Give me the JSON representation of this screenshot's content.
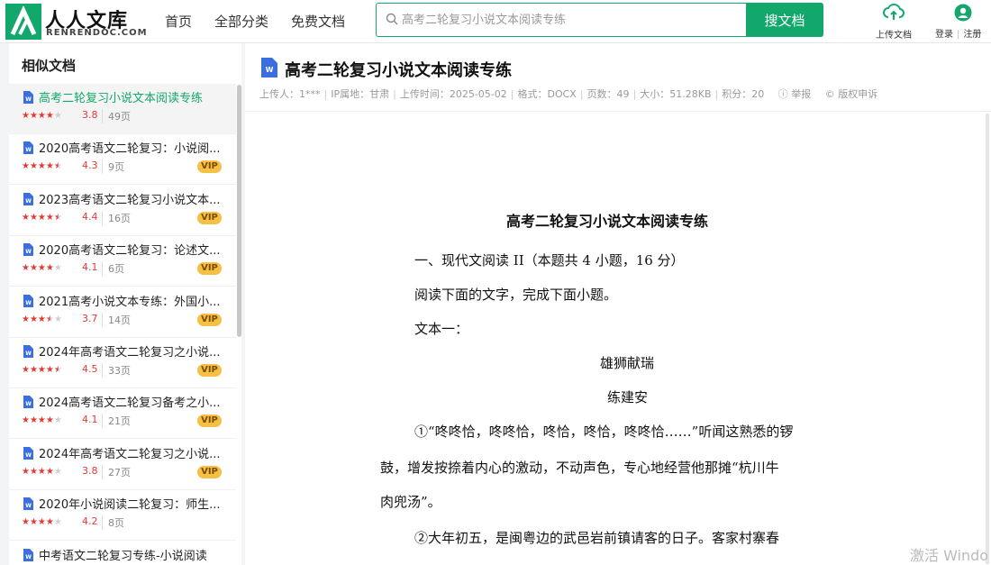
{
  "header": {
    "logo_cn": "人人文库",
    "logo_en": "RENRENDOC.COM",
    "nav": [
      "首页",
      "全部分类",
      "免费文档"
    ],
    "search_placeholder": "高考二轮复习小说文本阅读专练",
    "search_button": "搜文档",
    "upload_label": "上传文档",
    "login_label": "登录",
    "register_label": "注册",
    "accent": "#13a86b"
  },
  "sidebar": {
    "title": "相似文档",
    "items": [
      {
        "title": "高考二轮复习小说文本阅读专练",
        "rating": "3.8",
        "stars": 4,
        "pages": "49页",
        "vip": ""
      },
      {
        "title": "2020高考语文二轮复习：小说阅...",
        "rating": "4.3",
        "stars": 4.5,
        "pages": "9页",
        "vip": "VIP"
      },
      {
        "title": "2023高考语文二轮复习小说文本...",
        "rating": "4.4",
        "stars": 4.5,
        "pages": "16页",
        "vip": "VIP"
      },
      {
        "title": "2020高考语文二轮复习：论述文...",
        "rating": "4.1",
        "stars": 4,
        "pages": "6页",
        "vip": "VIP"
      },
      {
        "title": "2021高考小说文本专练：外国小...",
        "rating": "3.7",
        "stars": 3.5,
        "pages": "14页",
        "vip": "VIP"
      },
      {
        "title": "2024年高考语文二轮复习之小说...",
        "rating": "4.5",
        "stars": 4.5,
        "pages": "33页",
        "vip": "VIP"
      },
      {
        "title": "2024高考语文二轮复习备考之小...",
        "rating": "4.1",
        "stars": 4,
        "pages": "21页",
        "vip": "VIP"
      },
      {
        "title": "2024年高考语文二轮复习之小说...",
        "rating": "3.8",
        "stars": 4,
        "pages": "27页",
        "vip": "VIP"
      },
      {
        "title": "2020年小说阅读二轮复习：师生...",
        "rating": "4.2",
        "stars": 4,
        "pages": "8页",
        "vip": ""
      },
      {
        "title": "中考语文二轮复习专练-小说阅读",
        "rating": "",
        "stars": 0,
        "pages": "",
        "vip": ""
      }
    ]
  },
  "doc": {
    "title": "高考二轮复习小说文本阅读专练",
    "meta": {
      "uploader": "上传人：1***",
      "ip": "IP属地：甘肃",
      "time": "上传时间：2025-05-02",
      "format": "格式：DOCX",
      "pages": "页数：49",
      "size": "大小：51.28KB",
      "points": "积分：20",
      "report": "举报",
      "copyright": "版权申诉"
    },
    "content": {
      "title": "高考二轮复习小说文本阅读专练",
      "l1": "一、现代文阅读 II（本题共 4 小题，16 分）",
      "l2": "阅读下面的文字，完成下面小题。",
      "l3": "文本一：",
      "l4": "雄狮献瑞",
      "l5": "练建安",
      "l6": "①“咚咚恰，咚咚恰，咚恰，咚恰，咚咚恰……”听闻这熟悉的锣",
      "l7": "鼓，增发按捺着内心的激动，不动声色，专心地经营他那摊“杭川牛",
      "l8": "肉兜汤”。",
      "l9": "②大年初五，是闽粤边的武邑岩前镇请客的日子。客家村寨春"
    }
  },
  "watermark": "激活 Windo"
}
